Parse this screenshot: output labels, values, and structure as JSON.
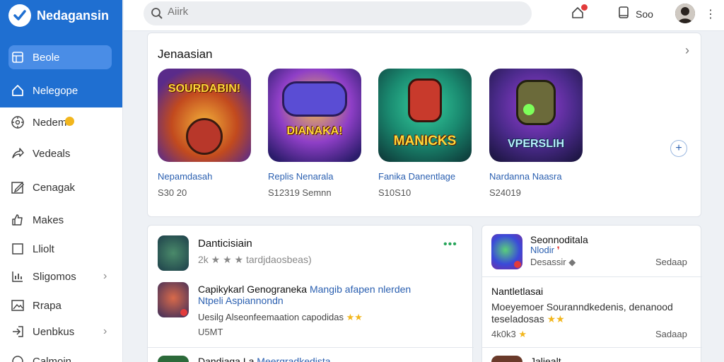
{
  "app": {
    "title": "Nedagansin"
  },
  "sidebar": {
    "items": [
      {
        "label": "Beole",
        "icon": "grid-icon",
        "active": true
      },
      {
        "label": "Nelegope",
        "icon": "home-icon"
      },
      {
        "label": "Nedem",
        "icon": "compass-icon"
      },
      {
        "label": "Vedeals",
        "icon": "share-icon"
      },
      {
        "label": "Cenagak",
        "icon": "edit-icon"
      },
      {
        "label": "Makes",
        "icon": "thumbs-up-icon"
      },
      {
        "label": "Lliolt",
        "icon": "square-icon"
      },
      {
        "label": "Sligomos",
        "icon": "chart-icon",
        "chevron": true
      },
      {
        "label": "Rrapa",
        "icon": "image-icon"
      },
      {
        "label": "Uenbkus",
        "icon": "login-icon",
        "chevron": true
      },
      {
        "label": "Calmoin",
        "icon": "circle-icon"
      }
    ]
  },
  "topbar": {
    "search_placeholder": "Aiirk",
    "user_label": "Soo"
  },
  "featured": {
    "title": "Jenaasian",
    "games": [
      {
        "tile_text": "SOURDABIN!",
        "name": "Nepamdasah",
        "meta": "S30 20"
      },
      {
        "tile_text": "DIANAKA!",
        "name": "Replis Nenarala",
        "meta": "S12319 Semnn"
      },
      {
        "tile_text": "MANICKS",
        "name": "Fanika Danentlage",
        "meta": "S10S10"
      },
      {
        "tile_text": "VPERSLIH",
        "name": "Nardanna Naasra",
        "meta": "S24019"
      }
    ]
  },
  "list_left": {
    "title": "Danticisiain",
    "rating_text": "tardjdaosbeas)",
    "row_title": "Capikykarl Genograneka",
    "row_link": "Mangib afapen nlerden",
    "row_link2": "Ntpeli Aspiannondn",
    "row_desc": "Uesilg Alseonfeemaation capodidas",
    "row_meta": "U5MT",
    "row3_title": "Dandiaga La",
    "row3_link": "Meergradkedista"
  },
  "list_right": {
    "title": "Seonnoditala",
    "link": "Nlodir",
    "desc": "Desassir",
    "side1": "Sedaap",
    "block_title": "Nantletlasai",
    "block_line1": "Moeyemoer Souranndkedenis, denanood",
    "block_line2": "teseladosas",
    "block_meta": "4k0k3",
    "side2": "Sadaap",
    "row3_title": "Jaliealt"
  },
  "colors": {
    "brand": "#1f6fd1",
    "active_item": "#4a8de6",
    "link": "#2a5fb0",
    "accent_green": "#27a55a",
    "star": "#f2b61d"
  }
}
